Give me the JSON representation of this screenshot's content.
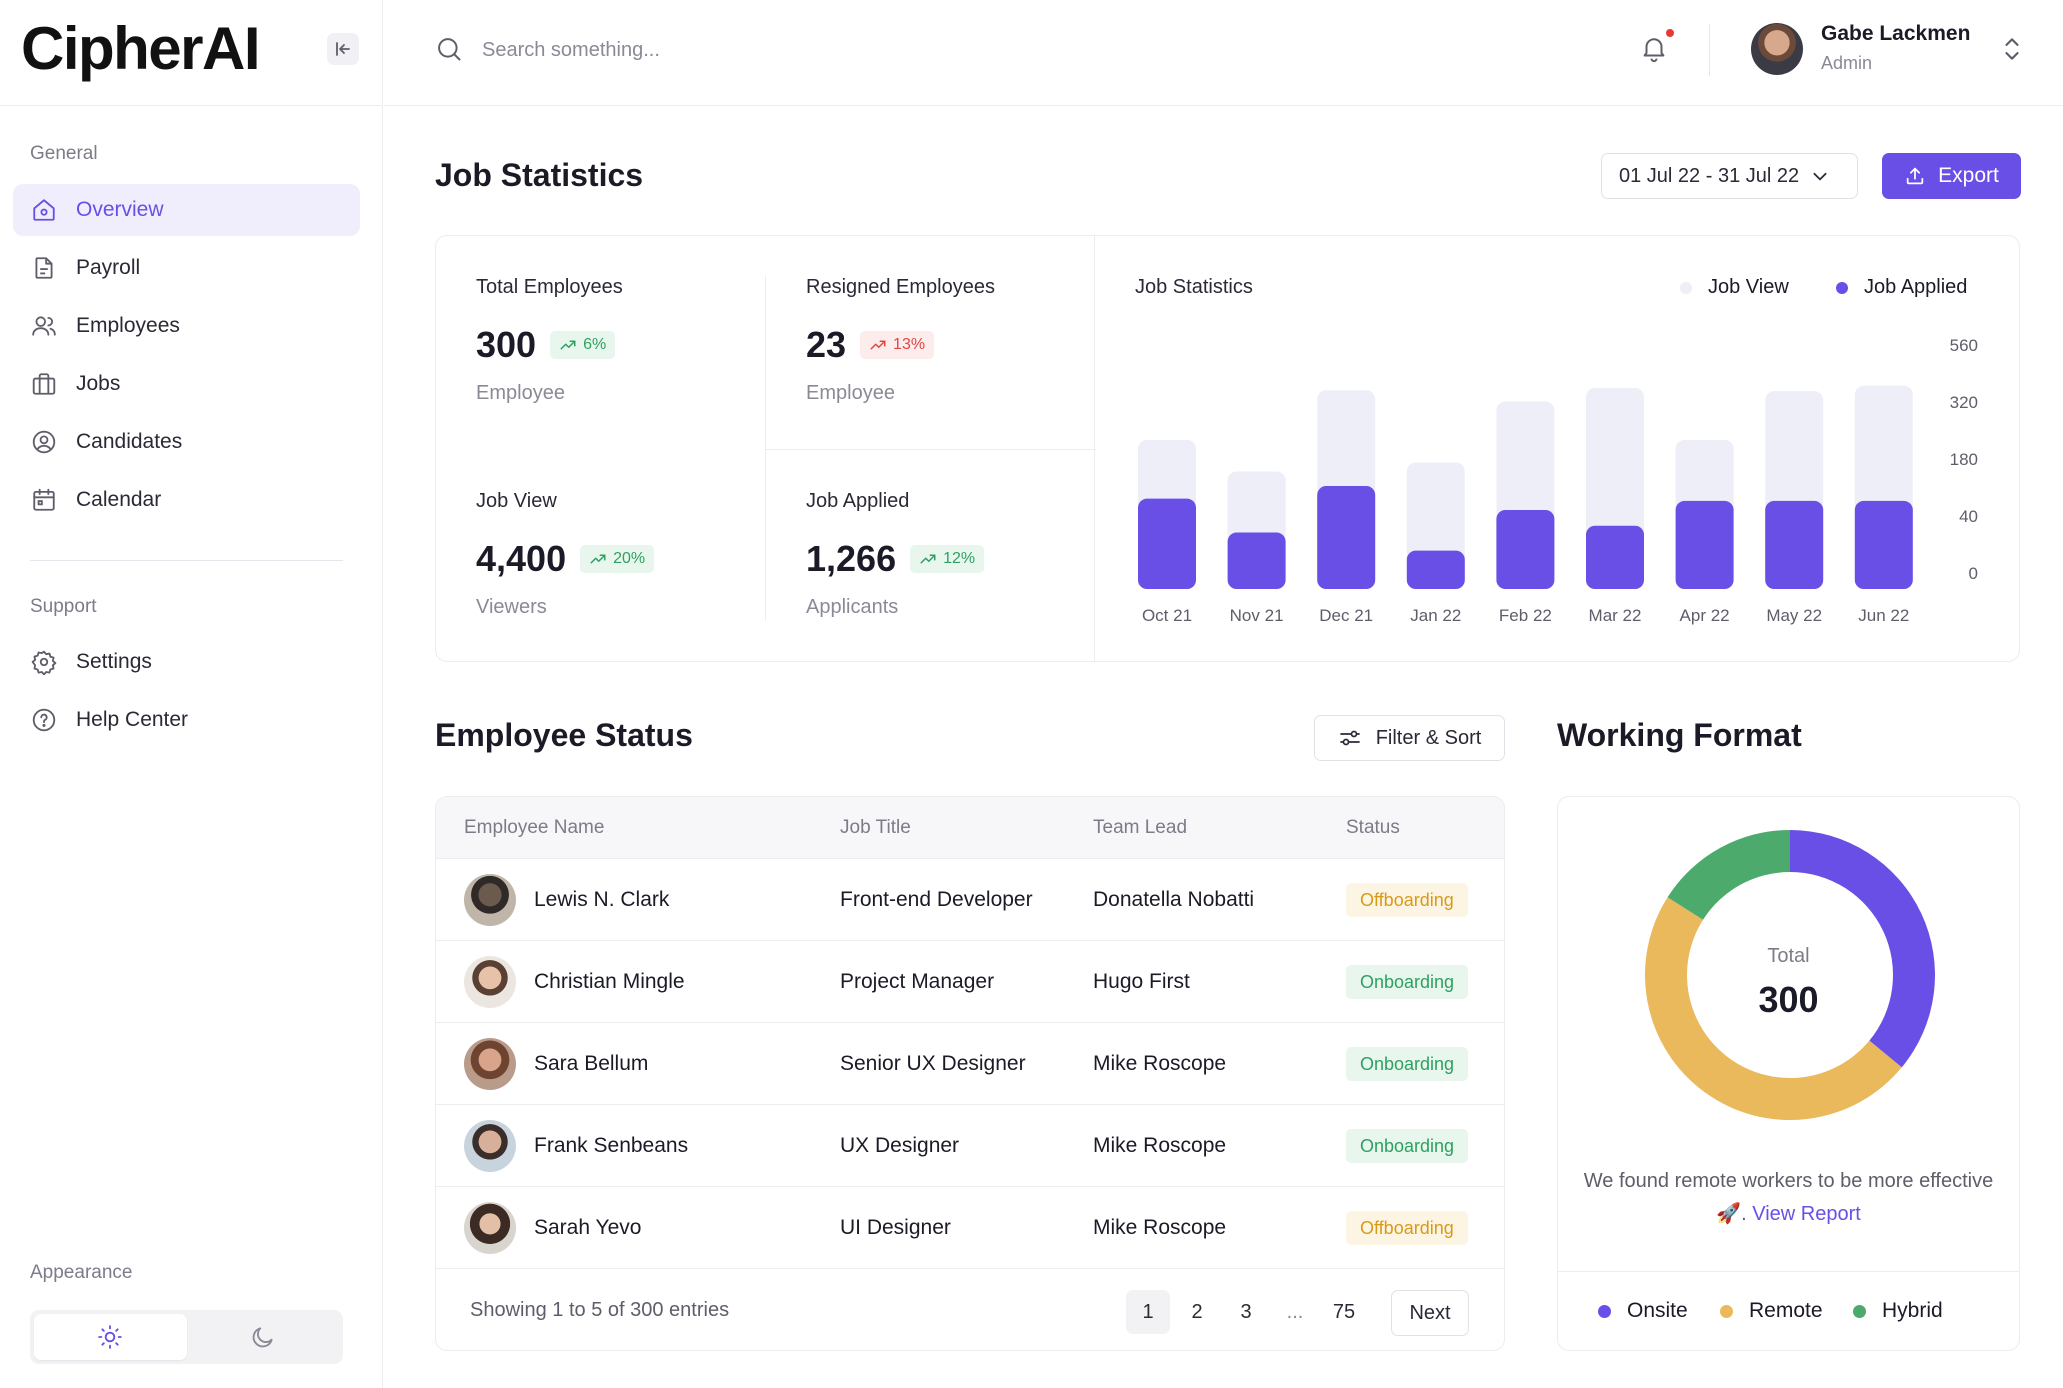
{
  "app": {
    "logo": "CipherAI"
  },
  "sidebar": {
    "general_label": "General",
    "items": [
      {
        "label": "Overview",
        "icon": "home-icon",
        "active": true
      },
      {
        "label": "Payroll",
        "icon": "document-icon"
      },
      {
        "label": "Employees",
        "icon": "users-icon"
      },
      {
        "label": "Jobs",
        "icon": "briefcase-icon"
      },
      {
        "label": "Candidates",
        "icon": "user-circle-icon"
      },
      {
        "label": "Calendar",
        "icon": "calendar-icon"
      }
    ],
    "support_label": "Support",
    "support_items": [
      {
        "label": "Settings",
        "icon": "gear-icon"
      },
      {
        "label": "Help Center",
        "icon": "help-icon"
      }
    ],
    "appearance_label": "Appearance",
    "appearance_mode": "light"
  },
  "topbar": {
    "search_placeholder": "Search something...",
    "user": {
      "name": "Gabe Lackmen",
      "role": "Admin"
    },
    "has_notification": true
  },
  "job_stats": {
    "title": "Job Statistics",
    "date_range": "01 Jul 22 - 31 Jul 22",
    "export_label": "Export",
    "cards": [
      {
        "label": "Total Employees",
        "value": "300",
        "change": "6%",
        "trend": "up",
        "unit": "Employee"
      },
      {
        "label": "Resigned Employees",
        "value": "23",
        "change": "13%",
        "trend": "down",
        "unit": "Employee"
      },
      {
        "label": "Job View",
        "value": "4,400",
        "change": "20%",
        "trend": "up",
        "unit": "Viewers"
      },
      {
        "label": "Job Applied",
        "value": "1,266",
        "change": "12%",
        "trend": "up",
        "unit": "Applicants"
      }
    ]
  },
  "chart_data": {
    "type": "bar",
    "title": "Job Statistics",
    "categories": [
      "Oct 21",
      "Nov 21",
      "Dec 21",
      "Jan 22",
      "Feb 22",
      "Mar 22",
      "Apr 22",
      "May 22",
      "Jun 22"
    ],
    "series": [
      {
        "name": "Job View",
        "color": "#eeeef8",
        "values": [
          330,
          260,
          440,
          280,
          415,
          445,
          330,
          438,
          450
        ]
      },
      {
        "name": "Job Applied",
        "color": "#6a4fe6",
        "values": [
          200,
          125,
          228,
          85,
          175,
          140,
          195,
          195,
          195
        ]
      }
    ],
    "y_ticks": [
      "560",
      "320",
      "180",
      "40",
      "0"
    ],
    "ylim": [
      0,
      560
    ],
    "stacked": "overlay",
    "legend_position": "top-right",
    "grid": false
  },
  "employee_status": {
    "title": "Employee Status",
    "filter_label": "Filter & Sort",
    "columns": [
      "Employee Name",
      "Job Title",
      "Team Lead",
      "Status"
    ],
    "rows": [
      {
        "name": "Lewis N. Clark",
        "job": "Front-end Developer",
        "lead": "Donatella Nobatti",
        "status": "Offboarding"
      },
      {
        "name": "Christian Mingle",
        "job": "Project Manager",
        "lead": "Hugo First",
        "status": "Onboarding"
      },
      {
        "name": "Sara Bellum",
        "job": "Senior UX Designer",
        "lead": "Mike Roscope",
        "status": "Onboarding"
      },
      {
        "name": "Frank Senbeans",
        "job": "UX Designer",
        "lead": "Mike Roscope",
        "status": "Onboarding"
      },
      {
        "name": "Sarah Yevo",
        "job": "UI Designer",
        "lead": "Mike Roscope",
        "status": "Offboarding"
      }
    ],
    "footer": {
      "showing": "Showing 1 to 5 of 300 entries",
      "pages": [
        "1",
        "2",
        "3",
        "...",
        "75"
      ],
      "current_page": "1",
      "next_label": "Next"
    }
  },
  "working_format": {
    "title": "Working Format",
    "total_label": "Total",
    "total_value": "300",
    "note_prefix": "We found remote workers to be more effective 🚀.",
    "note_link": "View Report",
    "segments": [
      {
        "name": "Onsite",
        "color": "#6a4fe6",
        "value": 0.36
      },
      {
        "name": "Remote",
        "color": "#e9b95c",
        "value": 0.48
      },
      {
        "name": "Hybrid",
        "color": "#4caa6d",
        "value": 0.16
      }
    ]
  }
}
